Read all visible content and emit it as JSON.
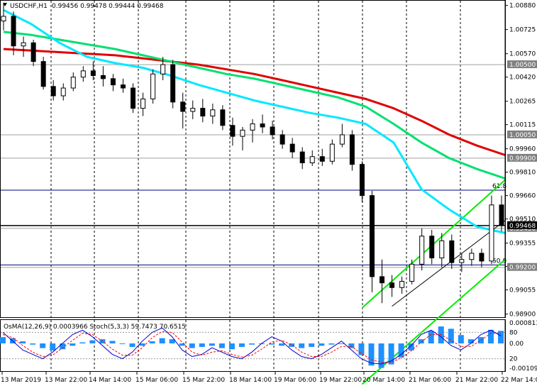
{
  "header": {
    "symbol": "USDCHF,H1",
    "ohlc": "0.99456 0.99478 0.99444 0.99468"
  },
  "colors": {
    "bull_candle": "#000000",
    "bear_candle": "#000000",
    "ma_red": "#e00000",
    "ma_green": "#00e070",
    "ma_cyan": "#00e8ff",
    "channel": "#00ee00",
    "level_line": "#000080",
    "histogram": "#1e90ff",
    "stoch_main": "#0000cc",
    "stoch_signal": "#ff0000",
    "price_tag_bg": "#808080"
  },
  "chart_data": {
    "type": "line",
    "price_axis": {
      "ticks": [
        "1.00880",
        "1.00725",
        "1.00570",
        "1.00420",
        "1.00265",
        "1.00115",
        "0.99960",
        "0.99810",
        "0.99660",
        "0.99510",
        "0.99355",
        "0.99205",
        "0.99055",
        "0.98900"
      ],
      "ylim": [
        0.9888,
        1.0091
      ]
    },
    "time_axis": {
      "ticks": [
        "13 Mar 2019",
        "13 Mar 22:00",
        "14 Mar 14:00",
        "15 Mar 06:00",
        "15 Mar 22:00",
        "18 Mar 14:00",
        "19 Mar 06:00",
        "19 Mar 22:00",
        "20 Mar 14:00",
        "21 Mar 06:00",
        "21 Mar 22:00",
        "22 Mar 14:00"
      ]
    },
    "horizontal_levels": [
      {
        "value": 1.005,
        "label": "1.00500"
      },
      {
        "value": 1.0005,
        "label": "1.00050"
      },
      {
        "value": 0.999,
        "label": "0.99900"
      },
      {
        "value": 0.9945,
        "label": "0.99450"
      },
      {
        "value": 0.992,
        "label": "0.99200"
      }
    ],
    "fib_levels": [
      {
        "value": 0.99695,
        "label": "61.8"
      },
      {
        "value": 0.99215,
        "label": "50.0"
      }
    ],
    "current_price": {
      "value": 0.99468,
      "label": "0.99468"
    },
    "series": [
      {
        "color_key": "ma_red",
        "values": [
          1.006,
          1.0059,
          1.0058,
          1.0057,
          1.0056,
          1.0054,
          1.0052,
          1.005,
          1.0047,
          1.0044,
          1.004,
          1.0036,
          1.0032,
          1.0028,
          1.0022,
          1.0014,
          1.0005,
          0.9998,
          0.9992
        ]
      },
      {
        "color_key": "ma_green",
        "values": [
          1.0071,
          1.0069,
          1.0066,
          1.0063,
          1.006,
          1.0056,
          1.0052,
          1.0048,
          1.0044,
          1.0041,
          1.0037,
          1.0033,
          1.0029,
          1.0023,
          1.0012,
          1.0,
          0.999,
          0.9983,
          0.9977
        ]
      },
      {
        "color_key": "ma_cyan",
        "values": [
          1.0085,
          1.0076,
          1.0064,
          1.0055,
          1.0051,
          1.0048,
          1.0043,
          1.0037,
          1.0032,
          1.0027,
          1.0023,
          1.0019,
          1.0016,
          1.0012,
          1.0,
          0.997,
          0.9957,
          0.9946,
          0.9942
        ]
      }
    ],
    "candles": [
      {
        "o": 1.0078,
        "h": 1.0089,
        "l": 1.0072,
        "c": 1.0081
      },
      {
        "o": 1.0081,
        "h": 1.0084,
        "l": 1.0056,
        "c": 1.0062
      },
      {
        "o": 1.0062,
        "h": 1.0068,
        "l": 1.0055,
        "c": 1.0064
      },
      {
        "o": 1.0064,
        "h": 1.0066,
        "l": 1.0049,
        "c": 1.0052
      },
      {
        "o": 1.0052,
        "h": 1.0055,
        "l": 1.0034,
        "c": 1.0036
      },
      {
        "o": 1.0036,
        "h": 1.004,
        "l": 1.0027,
        "c": 1.003
      },
      {
        "o": 1.003,
        "h": 1.0038,
        "l": 1.0027,
        "c": 1.0035
      },
      {
        "o": 1.0035,
        "h": 1.0045,
        "l": 1.0033,
        "c": 1.0042
      },
      {
        "o": 1.0042,
        "h": 1.0049,
        "l": 1.0039,
        "c": 1.0046
      },
      {
        "o": 1.0046,
        "h": 1.0052,
        "l": 1.004,
        "c": 1.0043
      },
      {
        "o": 1.0043,
        "h": 1.0049,
        "l": 1.0036,
        "c": 1.0041
      },
      {
        "o": 1.0041,
        "h": 1.0044,
        "l": 1.0033,
        "c": 1.0037
      },
      {
        "o": 1.0037,
        "h": 1.0041,
        "l": 1.0032,
        "c": 1.0035
      },
      {
        "o": 1.0035,
        "h": 1.0038,
        "l": 1.0019,
        "c": 1.0022
      },
      {
        "o": 1.0022,
        "h": 1.0032,
        "l": 1.0017,
        "c": 1.0028
      },
      {
        "o": 1.0028,
        "h": 1.0047,
        "l": 1.0025,
        "c": 1.0044
      },
      {
        "o": 1.0044,
        "h": 1.0055,
        "l": 1.004,
        "c": 1.005
      },
      {
        "o": 1.005,
        "h": 1.0053,
        "l": 1.0022,
        "c": 1.0026
      },
      {
        "o": 1.0026,
        "h": 1.0032,
        "l": 1.0009,
        "c": 1.002
      },
      {
        "o": 1.002,
        "h": 1.0027,
        "l": 1.0015,
        "c": 1.0022
      },
      {
        "o": 1.0022,
        "h": 1.0028,
        "l": 1.0013,
        "c": 1.0017
      },
      {
        "o": 1.0017,
        "h": 1.0025,
        "l": 1.0012,
        "c": 1.0021
      },
      {
        "o": 1.0021,
        "h": 1.0024,
        "l": 1.0008,
        "c": 1.0011
      },
      {
        "o": 1.0011,
        "h": 1.0016,
        "l": 0.9998,
        "c": 1.0004
      },
      {
        "o": 1.0004,
        "h": 1.001,
        "l": 0.9995,
        "c": 1.0008
      },
      {
        "o": 1.0008,
        "h": 1.0015,
        "l": 1.0,
        "c": 1.0012
      },
      {
        "o": 1.0012,
        "h": 1.0018,
        "l": 1.0006,
        "c": 1.001
      },
      {
        "o": 1.001,
        "h": 1.0014,
        "l": 1.0002,
        "c": 1.0005
      },
      {
        "o": 1.0005,
        "h": 1.0008,
        "l": 0.9996,
        "c": 0.9999
      },
      {
        "o": 0.9999,
        "h": 1.0003,
        "l": 0.999,
        "c": 0.9994
      },
      {
        "o": 0.9994,
        "h": 0.9997,
        "l": 0.9983,
        "c": 0.9987
      },
      {
        "o": 0.9987,
        "h": 0.9995,
        "l": 0.9985,
        "c": 0.9991
      },
      {
        "o": 0.9991,
        "h": 0.9996,
        "l": 0.9985,
        "c": 0.9988
      },
      {
        "o": 0.9988,
        "h": 1.0002,
        "l": 0.9986,
        "c": 0.9999
      },
      {
        "o": 0.9999,
        "h": 1.0012,
        "l": 0.9997,
        "c": 1.0005
      },
      {
        "o": 1.0005,
        "h": 1.0008,
        "l": 0.9982,
        "c": 0.9986
      },
      {
        "o": 0.9986,
        "h": 0.9988,
        "l": 0.9962,
        "c": 0.9966
      },
      {
        "o": 0.9966,
        "h": 0.9969,
        "l": 0.9904,
        "c": 0.9914
      },
      {
        "o": 0.9914,
        "h": 0.9925,
        "l": 0.9897,
        "c": 0.991
      },
      {
        "o": 0.991,
        "h": 0.9915,
        "l": 0.9901,
        "c": 0.9907
      },
      {
        "o": 0.9907,
        "h": 0.9914,
        "l": 0.9903,
        "c": 0.9911
      },
      {
        "o": 0.9911,
        "h": 0.9925,
        "l": 0.9909,
        "c": 0.9922
      },
      {
        "o": 0.9922,
        "h": 0.9945,
        "l": 0.9918,
        "c": 0.994
      },
      {
        "o": 0.994,
        "h": 0.9944,
        "l": 0.9922,
        "c": 0.9926
      },
      {
        "o": 0.9926,
        "h": 0.9942,
        "l": 0.992,
        "c": 0.9937
      },
      {
        "o": 0.9937,
        "h": 0.9941,
        "l": 0.9919,
        "c": 0.9923
      },
      {
        "o": 0.9923,
        "h": 0.9929,
        "l": 0.9917,
        "c": 0.9925
      },
      {
        "o": 0.9925,
        "h": 0.9932,
        "l": 0.9921,
        "c": 0.9929
      },
      {
        "o": 0.9929,
        "h": 0.9932,
        "l": 0.992,
        "c": 0.9924
      },
      {
        "o": 0.9924,
        "h": 0.9966,
        "l": 0.9922,
        "c": 0.996
      },
      {
        "o": 0.996,
        "h": 0.9966,
        "l": 0.9943,
        "c": 0.9947
      }
    ],
    "oscillator": {
      "label": "OsMA(12,26,9) 0.0003966  Stoch(5,3,3) 59.7473 70.6515",
      "axis_ticks": [
        "0.00081338",
        "80",
        "0.00",
        "20",
        "-0.001095"
      ],
      "histogram": [
        0.0003,
        0.00025,
        0.0001,
        -5e-05,
        -0.0002,
        -0.0003,
        -0.00025,
        -0.0001,
        5e-05,
        0.00015,
        0.0002,
        0.00012,
        0.0,
        -0.00015,
        -0.0001,
        0.0001,
        0.00025,
        0.0002,
        -0.0001,
        -0.0002,
        -0.00015,
        -0.0001,
        -0.0002,
        -0.00025,
        -0.00015,
        -5e-05,
        0.0,
        -5e-05,
        -0.0001,
        -0.00015,
        -0.0002,
        -0.00015,
        -0.0001,
        -5e-05,
        0.0,
        -0.0002,
        -0.0005,
        -0.00095,
        -0.00105,
        -0.0009,
        -0.0006,
        -0.0003,
        0.0002,
        0.0006,
        0.00081,
        0.0007,
        0.0004,
        0.0002,
        0.0003,
        0.00065,
        0.0006
      ],
      "stoch_main": [
        80,
        60,
        40,
        30,
        20,
        35,
        55,
        75,
        85,
        70,
        50,
        30,
        20,
        35,
        60,
        80,
        90,
        70,
        40,
        25,
        30,
        45,
        35,
        25,
        20,
        35,
        55,
        70,
        60,
        40,
        25,
        20,
        30,
        45,
        60,
        40,
        20,
        10,
        8,
        15,
        30,
        50,
        75,
        85,
        70,
        50,
        40,
        55,
        75,
        85,
        72
      ],
      "stoch_signal": [
        75,
        68,
        50,
        35,
        25,
        28,
        45,
        62,
        78,
        75,
        60,
        42,
        28,
        28,
        45,
        68,
        82,
        80,
        58,
        35,
        28,
        35,
        38,
        30,
        24,
        28,
        42,
        58,
        62,
        52,
        35,
        25,
        25,
        35,
        48,
        48,
        32,
        18,
        12,
        12,
        22,
        38,
        58,
        75,
        75,
        62,
        48,
        48,
        62,
        78,
        78
      ]
    }
  }
}
